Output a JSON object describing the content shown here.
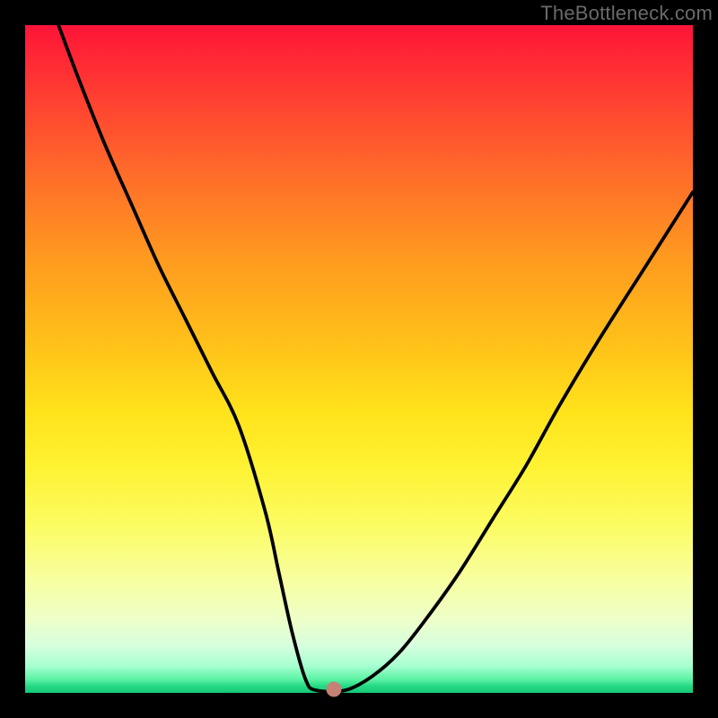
{
  "watermark": "TheBottleneck.com",
  "chart_data": {
    "type": "line",
    "title": "",
    "xlabel": "",
    "ylabel": "",
    "xlim": [
      0,
      100
    ],
    "ylim": [
      0,
      100
    ],
    "grid": false,
    "series": [
      {
        "name": "curve",
        "x": [
          5,
          8,
          12,
          16,
          20,
          24,
          28,
          32,
          36,
          38,
          40,
          42,
          43.5,
          48,
          52,
          56,
          60,
          65,
          70,
          75,
          80,
          86,
          93,
          100
        ],
        "y": [
          100,
          92,
          82,
          73,
          64,
          56,
          48,
          40,
          27,
          18,
          9,
          2,
          0.4,
          0.4,
          2.5,
          6,
          11,
          18,
          26,
          34,
          43,
          53,
          64,
          75
        ]
      }
    ],
    "marker": {
      "x": 46.2,
      "y": 0.6,
      "color": "#c58175"
    },
    "gradient_colors": {
      "top": "#ff1438",
      "mid": "#ffe31b",
      "bottom": "#17c877"
    }
  }
}
